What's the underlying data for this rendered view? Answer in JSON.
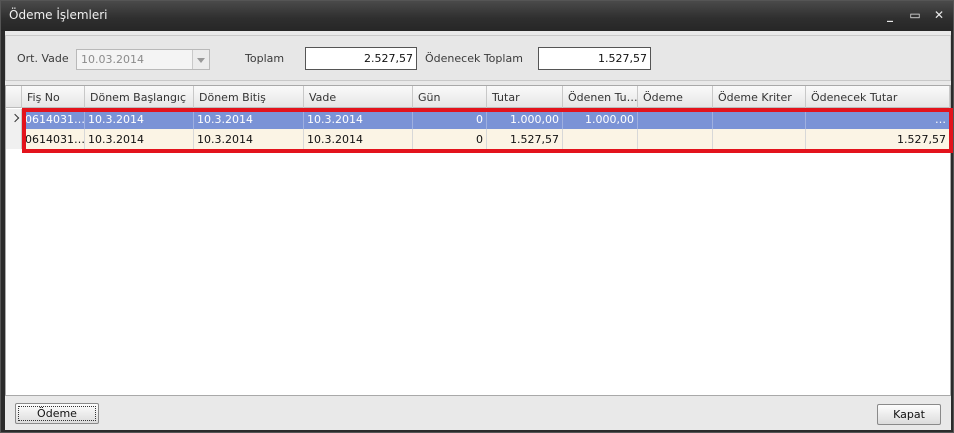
{
  "window": {
    "title": "Ödeme İşlemleri",
    "minimize_glyph": "_",
    "maximize_glyph": "▭",
    "close_glyph": "✕"
  },
  "header": {
    "avg_due_label": "Ort. Vade",
    "avg_due_value": "10.03.2014",
    "total_label": "Toplam",
    "total_value": "2.527,57",
    "payable_total_label": "Ödenecek Toplam",
    "payable_total_value": "1.527,57"
  },
  "grid": {
    "columns": [
      "Fiş No",
      "Dönem Başlangıç",
      "Dönem Bitiş",
      "Vade",
      "Gün",
      "Tutar",
      "Ödenen Tu…",
      "Ödeme",
      "Ödeme Kriter",
      "Ödenecek Tutar"
    ],
    "rows": [
      [
        "0614031…",
        "10.3.2014",
        "10.3.2014",
        "10.3.2014",
        "0",
        "1.000,00",
        "1.000,00",
        "",
        "",
        "…"
      ],
      [
        "0614031…",
        "10.3.2014",
        "10.3.2014",
        "10.3.2014",
        "0",
        "1.527,57",
        "",
        "",
        "",
        "1.527,57"
      ]
    ]
  },
  "footer": {
    "pay_button": "Ödeme",
    "close_button": "Kapat"
  },
  "colors": {
    "selected_row": "#7b93d6",
    "alt_row": "#fbf4e5",
    "highlight_border": "#e3131c"
  }
}
